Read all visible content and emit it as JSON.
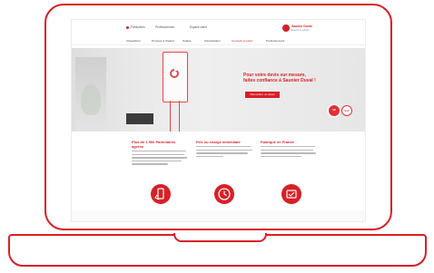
{
  "header": {
    "toplinks": [
      "Particuliers",
      "Professionnels",
      "Espace client"
    ],
    "logo_text": "Saunier Duval",
    "logo_sub": "Experts en confort"
  },
  "nav": {
    "items": [
      "Chaudières",
      "Pompes à chaleur",
      "Solaire",
      "Climatisation",
      "Conseils et aides",
      "Professionnels"
    ],
    "active_index": 4
  },
  "hero": {
    "title": "Pour votre devis sur mesure, faites confiance à Saunier Duval !",
    "button_label": "Demander un devis",
    "badge1": "SD",
    "badge2": "SAV"
  },
  "features": [
    {
      "title": "Plus de 1 500 Partenaires agréés",
      "icon": "phone-icon"
    },
    {
      "title": "Prix ou charge immédiate",
      "icon": "clock-icon"
    },
    {
      "title": "Fabriqué en France",
      "icon": "shield-icon"
    }
  ],
  "colors": {
    "accent": "#d91f26",
    "frame": "#d91f26"
  }
}
